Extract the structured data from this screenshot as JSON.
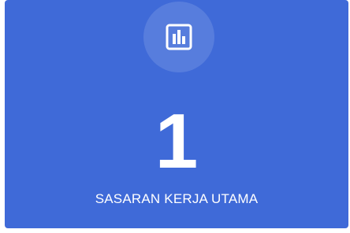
{
  "card": {
    "icon": "bar-chart-icon",
    "value": "1",
    "label": "SASARAN KERJA UTAMA",
    "background_color": "#3f6ad8",
    "text_color": "#ffffff"
  }
}
